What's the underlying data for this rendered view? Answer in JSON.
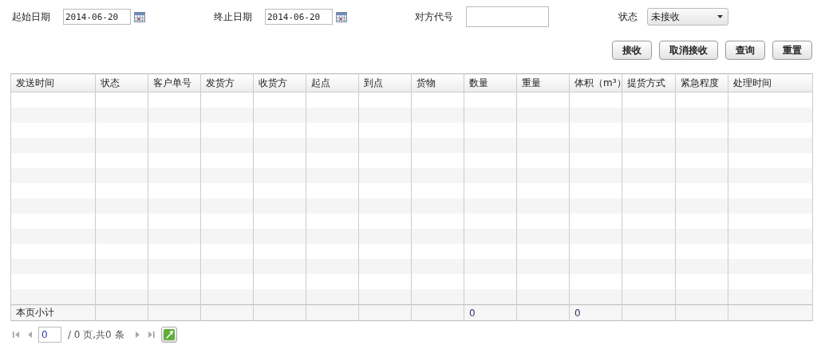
{
  "filters": [
    {
      "kind": "date",
      "label": "起始日期",
      "value": "2014-06-20"
    },
    {
      "kind": "date",
      "label": "终止日期",
      "value": "2014-06-20"
    },
    {
      "kind": "text",
      "label": "对方代号"
    },
    {
      "kind": "select",
      "label": "状态",
      "value": "未接收"
    }
  ],
  "buttons": [
    "接收",
    "取消接收",
    "查询",
    "重置"
  ],
  "table": {
    "columns": [
      {
        "title": "发送时间",
        "subtotal": "本页小计"
      },
      {
        "title": "状态"
      },
      {
        "title": "客户单号"
      },
      {
        "title": "发货方"
      },
      {
        "title": "收货方"
      },
      {
        "title": "起点"
      },
      {
        "title": "到点"
      },
      {
        "title": "货物"
      },
      {
        "title": "数量",
        "subtotal": "0"
      },
      {
        "title": "重量"
      },
      {
        "title": "体积（m³）",
        "subtotal": "0"
      },
      {
        "title": "提货方式"
      },
      {
        "title": "紧急程度"
      },
      {
        "title": "处理时间"
      }
    ]
  },
  "pager": {
    "page": "0",
    "summary": "/ 0 页,共0 条"
  }
}
